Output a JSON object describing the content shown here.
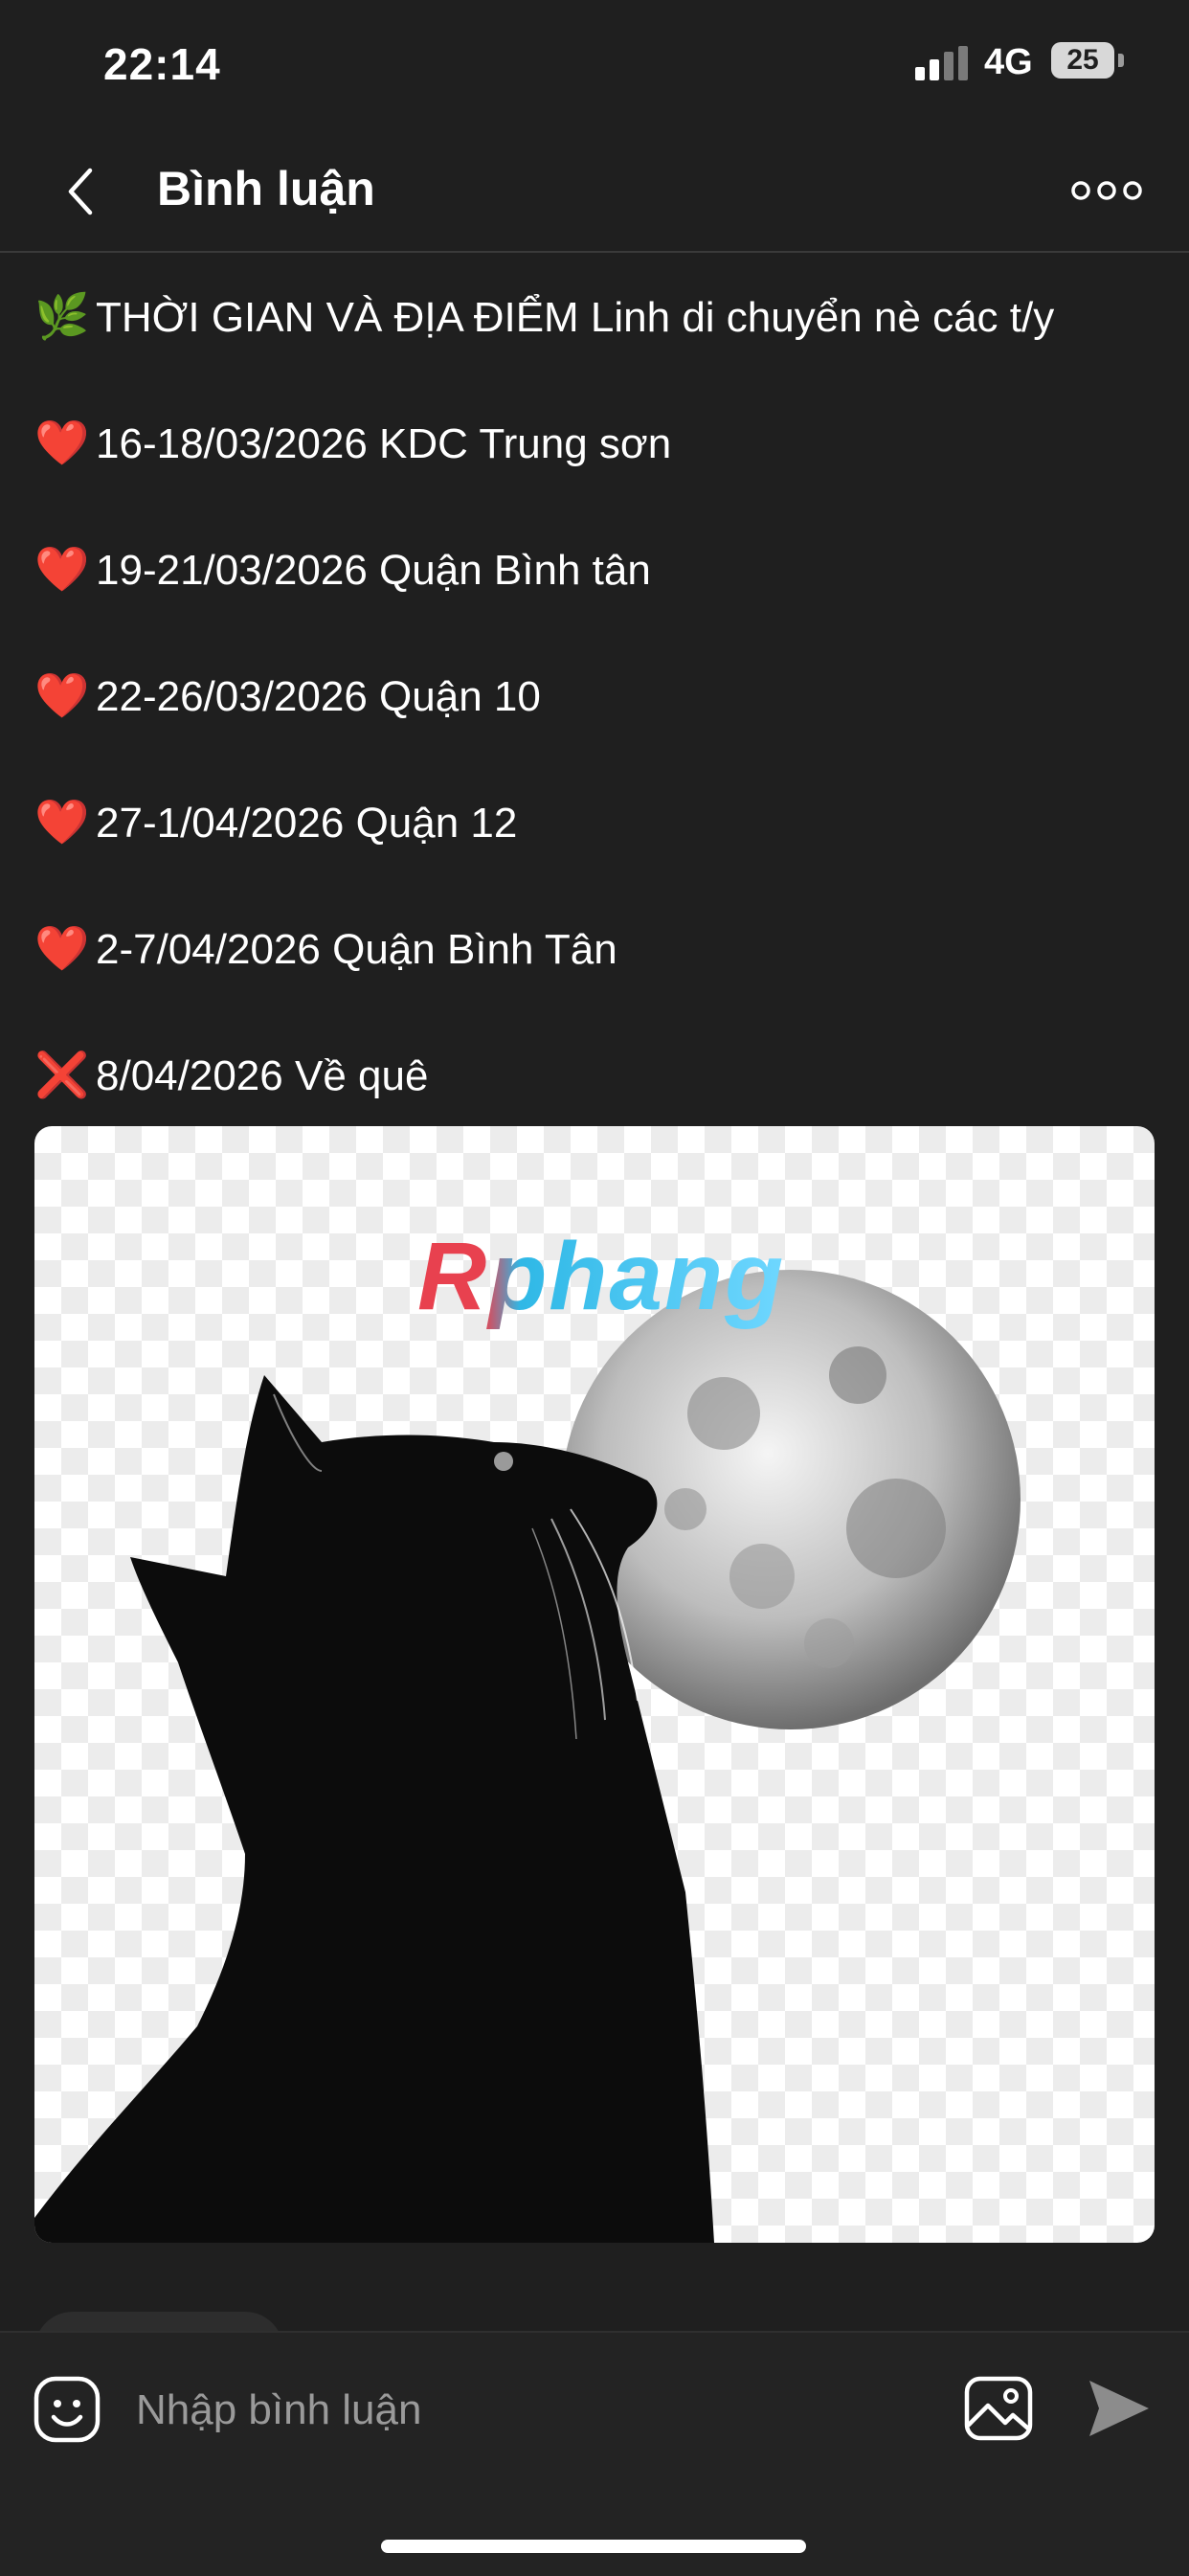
{
  "status_bar": {
    "time": "22:14",
    "network": "4G",
    "battery": "25"
  },
  "header": {
    "title": "Bình luận",
    "back_icon": "chevron-left-icon",
    "more_icon": "more-dots-icon"
  },
  "post": {
    "lines": [
      {
        "emoji": "🌿",
        "text": "THỜI GIAN VÀ ĐỊA ĐIỂM Linh di chuyển nè các t/y"
      },
      {
        "emoji": "❤️",
        "text": "16-18/03/2026 KDC Trung sơn"
      },
      {
        "emoji": "❤️",
        "text": "19-21/03/2026 Quận Bình tân"
      },
      {
        "emoji": "❤️",
        "text": "22-26/03/2026 Quận 10"
      },
      {
        "emoji": "❤️",
        "text": "27-1/04/2026 Quận 12"
      },
      {
        "emoji": "❤️",
        "text": "2-7/04/2026 Quận Bình Tân"
      },
      {
        "emoji": "❌",
        "text": "8/04/2026 Về quê"
      }
    ],
    "image_watermark": "Rphang"
  },
  "input_bar": {
    "placeholder": "Nhập bình luận",
    "emoji_icon": "smiley-icon",
    "image_icon": "image-icon",
    "send_icon": "send-icon"
  },
  "colors": {
    "background": "#1f1f1f",
    "input_bar": "#232323",
    "divider": "#3a3a3a",
    "placeholder": "#9a9a9a"
  }
}
